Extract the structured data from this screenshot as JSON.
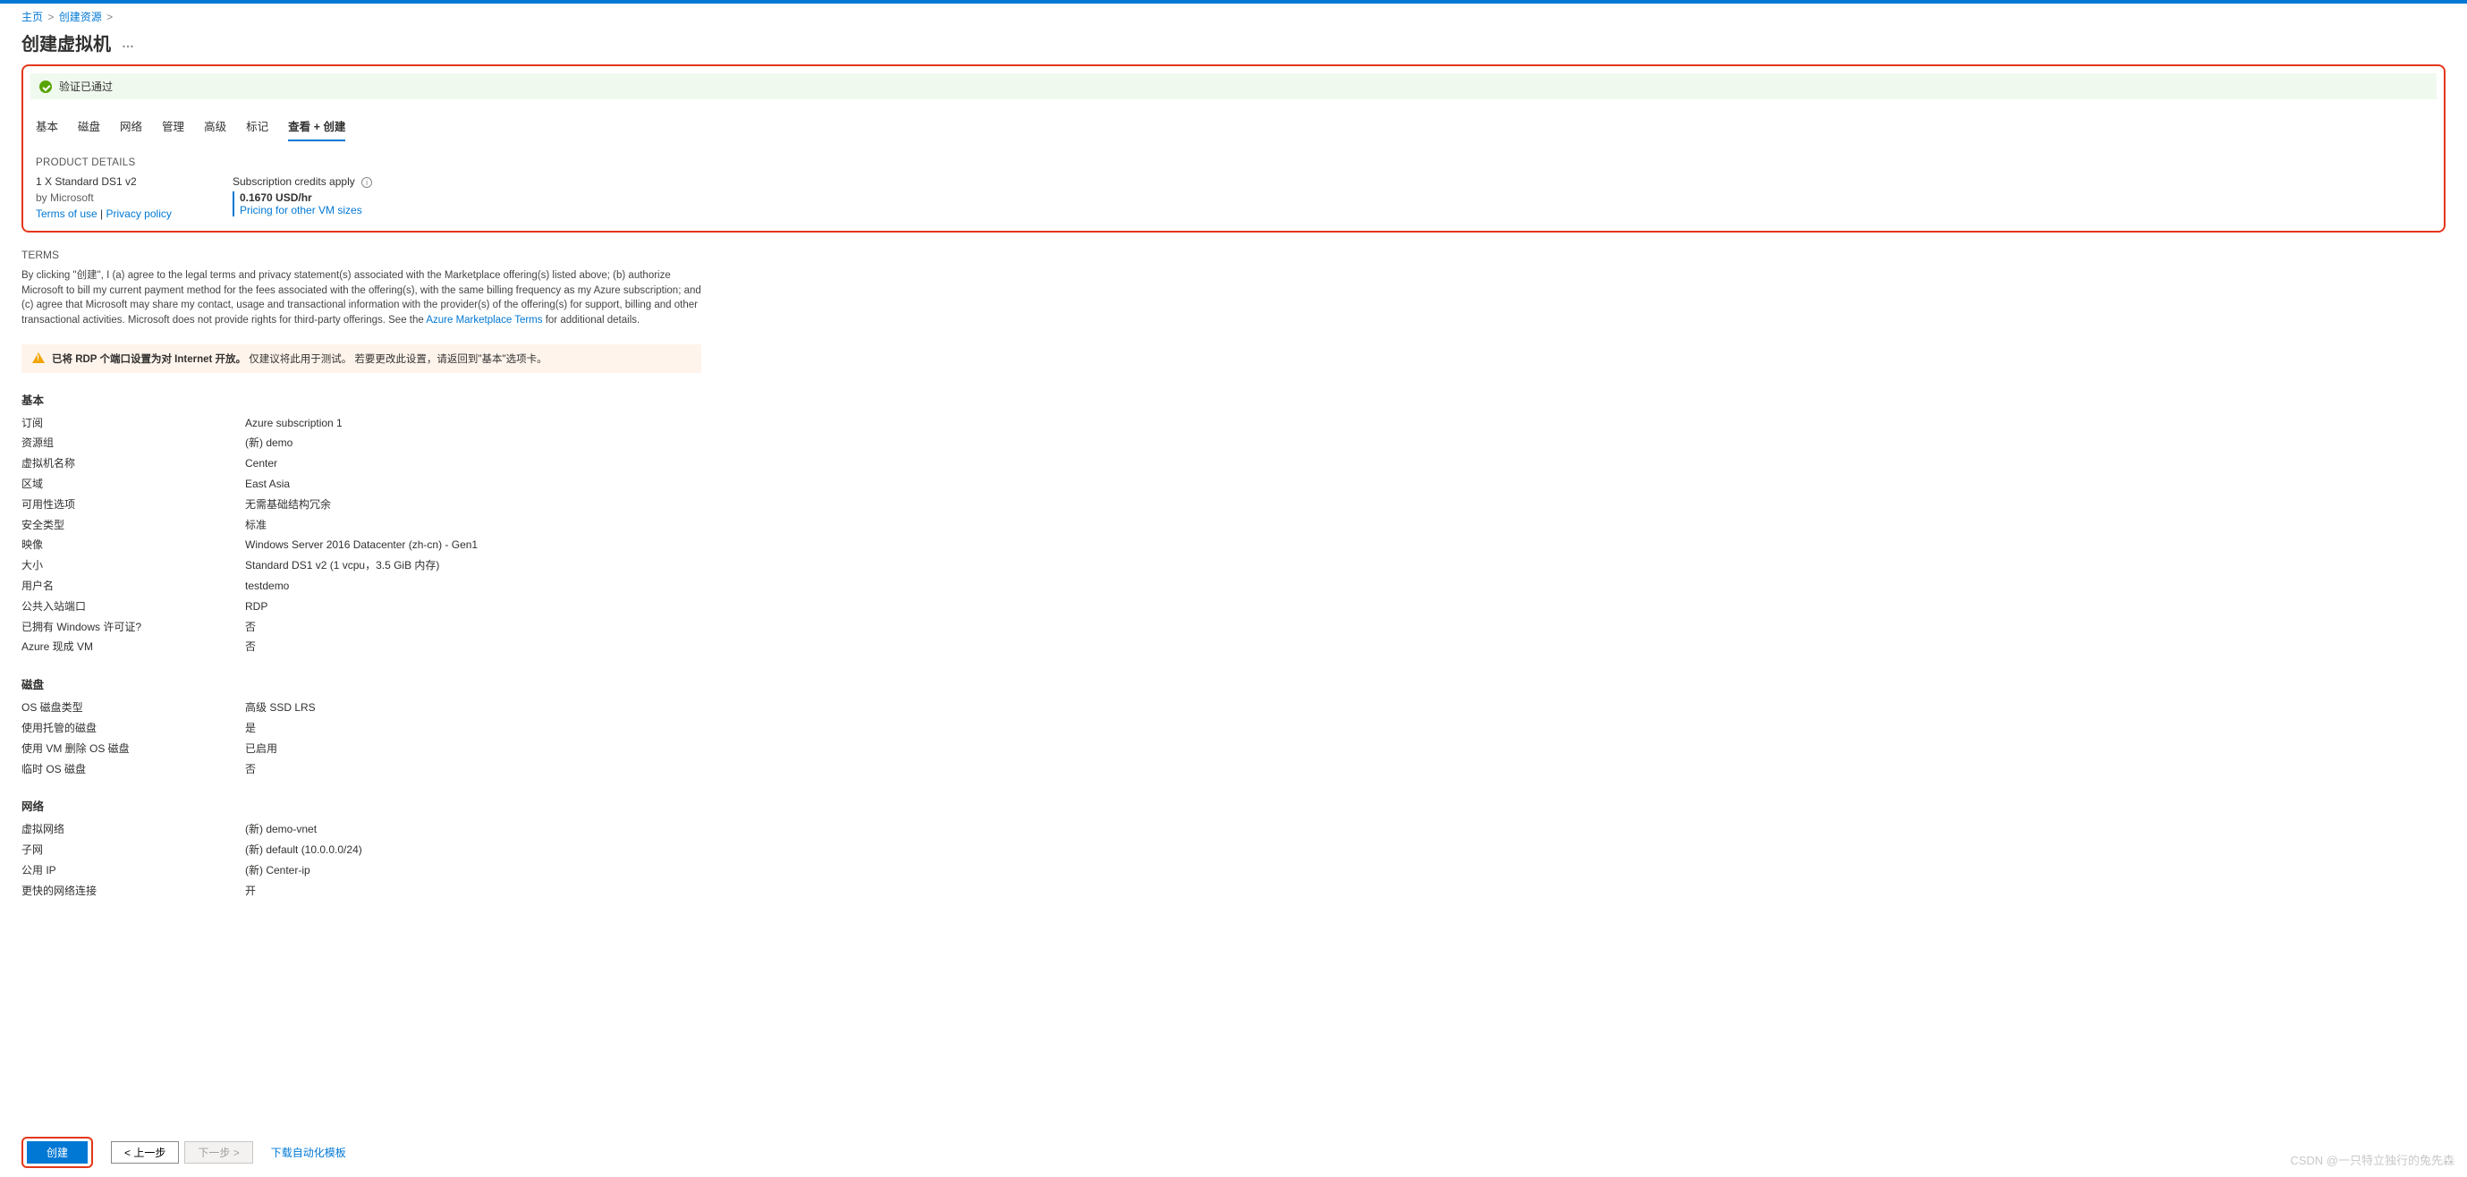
{
  "breadcrumb": {
    "home": "主页",
    "create_resource": "创建资源"
  },
  "page_title": "创建虚拟机",
  "page_title_dots": "…",
  "validation": {
    "passed_label": "验证已通过"
  },
  "tabs": {
    "basic": "基本",
    "disk": "磁盘",
    "network": "网络",
    "manage": "管理",
    "advanced": "高级",
    "tags": "标记",
    "review": "查看 + 创建"
  },
  "product": {
    "heading": "PRODUCT DETAILS",
    "sku": "1 X Standard DS1 v2",
    "by_label": "by Microsoft",
    "terms_link": "Terms of use",
    "privacy_link": "Privacy policy",
    "sep": " | ",
    "credits_label": "Subscription credits apply",
    "price": "0.1670 USD/hr",
    "pricing_link": "Pricing for other VM sizes"
  },
  "terms": {
    "heading": "TERMS",
    "body_prefix": "By clicking \"创建\", I (a) agree to the legal terms and privacy statement(s) associated with the Marketplace offering(s) listed above; (b) authorize Microsoft to bill my current payment method for the fees associated with the offering(s), with the same billing frequency as my Azure subscription; and (c) agree that Microsoft may share my contact, usage and transactional information with the provider(s) of the offering(s) for support, billing and other transactional activities. Microsoft does not provide rights for third-party offerings. See the ",
    "link": "Azure Marketplace Terms",
    "body_suffix": " for additional details."
  },
  "warning": {
    "bold": "已将 RDP 个端口设置为对 Internet 开放。",
    "rest": " 仅建议将此用于测试。 若要更改此设置，请返回到\"基本\"选项卡。"
  },
  "groups": {
    "basic": {
      "title": "基本",
      "rows": [
        {
          "k": "订阅",
          "v": "Azure subscription 1"
        },
        {
          "k": "资源组",
          "v": "(新) demo"
        },
        {
          "k": "虚拟机名称",
          "v": "Center"
        },
        {
          "k": "区域",
          "v": "East Asia"
        },
        {
          "k": "可用性选项",
          "v": "无需基础结构冗余"
        },
        {
          "k": "安全类型",
          "v": "标准"
        },
        {
          "k": "映像",
          "v": "Windows Server 2016 Datacenter (zh-cn) - Gen1"
        },
        {
          "k": "大小",
          "v": "Standard DS1 v2 (1 vcpu，3.5 GiB 内存)"
        },
        {
          "k": "用户名",
          "v": "testdemo"
        },
        {
          "k": "公共入站端口",
          "v": "RDP"
        },
        {
          "k": "已拥有 Windows 许可证?",
          "v": "否"
        },
        {
          "k": "Azure 现成 VM",
          "v": "否"
        }
      ]
    },
    "disk": {
      "title": "磁盘",
      "rows": [
        {
          "k": "OS 磁盘类型",
          "v": "高级 SSD LRS"
        },
        {
          "k": "使用托管的磁盘",
          "v": "是"
        },
        {
          "k": "使用 VM 删除 OS 磁盘",
          "v": "已启用"
        },
        {
          "k": "临时 OS 磁盘",
          "v": "否"
        }
      ]
    },
    "network": {
      "title": "网络",
      "rows": [
        {
          "k": "虚拟网络",
          "v": "(新) demo-vnet"
        },
        {
          "k": "子网",
          "v": "(新) default (10.0.0.0/24)"
        },
        {
          "k": "公用 IP",
          "v": "(新) Center-ip"
        },
        {
          "k": "更快的网络连接",
          "v": "开"
        }
      ]
    }
  },
  "footer": {
    "create": "创建",
    "prev": "< 上一步",
    "next": "下一步 >",
    "download": "下载自动化模板"
  },
  "watermark": "CSDN @一只特立独行的兔先森"
}
